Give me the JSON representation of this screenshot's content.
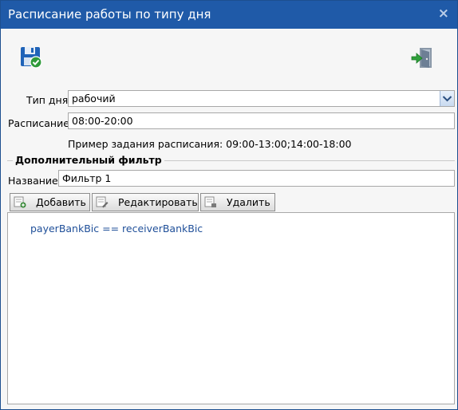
{
  "window": {
    "title": "Расписание работы по типу дня",
    "close": "×"
  },
  "toolbar": {
    "save_icon": "floppy-save-icon",
    "exit_icon": "exit-door-icon"
  },
  "form": {
    "day_type_label": "Тип дня",
    "day_type_value": "рабочий",
    "schedule_label": "Расписание",
    "schedule_value": "08:00-20:00",
    "schedule_hint": "Пример задания расписания: 09:00-13:00;14:00-18:00"
  },
  "filter": {
    "legend": "Дополнительный фильтр",
    "name_label": "Название",
    "name_value": "Фильтр 1",
    "buttons": {
      "add": "Добавить",
      "edit": "Редактировать",
      "delete": "Удалить"
    },
    "expression": "payerBankBic == receiverBankBic"
  },
  "colors": {
    "titlebar": "#1f5aa8",
    "expression_text": "#1f4f99"
  }
}
